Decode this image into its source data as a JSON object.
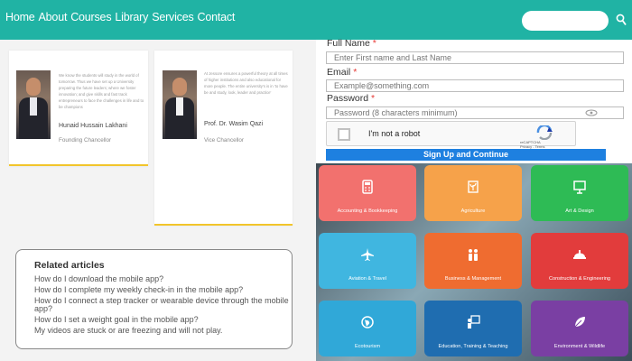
{
  "nav": {
    "links": [
      "Home",
      "About",
      "Courses",
      "Library",
      "Services",
      "Contact"
    ],
    "search_icon": "search-icon"
  },
  "cards": [
    {
      "bio": "We know the students will study in the world of tomorrow. Thus we have set up a University preparing the future leaders; where we foster innovation; and give skills and fast track entrepreneurs to face the challenges in life and to be champions",
      "name": "Hunaid Hussain Lakhani",
      "title": "Founding Chancellor"
    },
    {
      "bio": "At Jessore ensures a powerful theory at all times of higher institutions and also educational for more people. The entire university's is in 'to have be and study, look, leader and practice'",
      "name": "Prof. Dr. Wasim Qazi",
      "title": "Vice Chancellor"
    }
  ],
  "related": {
    "heading": "Related articles",
    "links": [
      "How do I download the mobile app?",
      "How do I complete my weekly check-in in the mobile app?",
      "How do I connect a step tracker or wearable device through the mobile app?",
      "How do I set a weight goal in the mobile app?",
      "My videos are stuck or are freezing and will not play."
    ]
  },
  "form": {
    "full_name_label": "Full Name",
    "full_name_placeholder": "Enter First name and Last Name",
    "email_label": "Email",
    "email_placeholder": "Example@something.com",
    "password_label": "Password",
    "password_placeholder": "Password (8 characters minimum)",
    "required_mark": "*",
    "captcha_label": "I'm not a robot",
    "captcha_brand": "reCAPTCHA",
    "captcha_links": "Privacy - Terms",
    "submit": "Sign Up and Continue"
  },
  "categories": [
    {
      "label": "Accounting & Bookkeeping",
      "color": "#f2716e",
      "icon": "calculator-icon"
    },
    {
      "label": "Agriculture",
      "color": "#f6a24a",
      "icon": "plant-icon"
    },
    {
      "label": "Art & Design",
      "color": "#2ebb55",
      "icon": "easel-icon"
    },
    {
      "label": "Aviation & Travel",
      "color": "#40b6e0",
      "icon": "airplane-icon"
    },
    {
      "label": "Business & Management",
      "color": "#ef6c30",
      "icon": "people-icon"
    },
    {
      "label": "Construction & Engineering",
      "color": "#e23c3c",
      "icon": "helmet-icon"
    },
    {
      "label": "Ecotourism",
      "color": "#30a8d8",
      "icon": "globe-icon"
    },
    {
      "label": "Education, Training & Teaching",
      "color": "#1f6db0",
      "icon": "teacher-icon"
    },
    {
      "label": "Environment & Wildlife",
      "color": "#7a3fa3",
      "icon": "leaf-icon"
    }
  ]
}
